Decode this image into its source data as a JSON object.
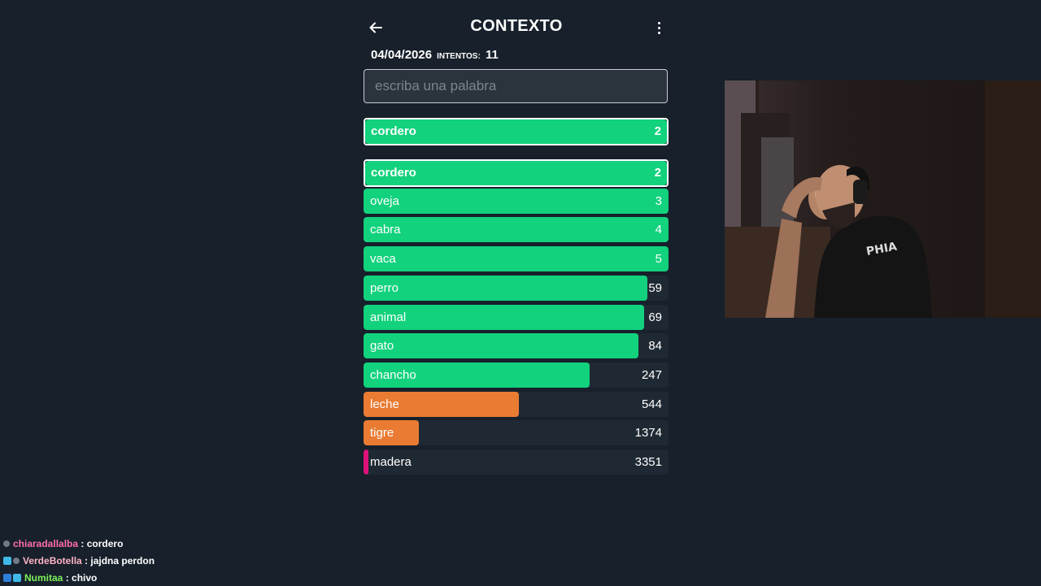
{
  "game": {
    "title": "CONTEXTO",
    "date": "04/04/2026",
    "attempts_label": "INTENTOS:",
    "attempts": "11",
    "search_placeholder": "escriba una palabra",
    "last_guess": {
      "word": "cordero",
      "rank": "2",
      "fill": 1.0,
      "color": "green"
    },
    "guesses": [
      {
        "word": "cordero",
        "rank": "2",
        "fill": 1.0,
        "color": "green",
        "highlight": true
      },
      {
        "word": "oveja",
        "rank": "3",
        "fill": 1.0,
        "color": "green"
      },
      {
        "word": "cabra",
        "rank": "4",
        "fill": 1.0,
        "color": "green"
      },
      {
        "word": "vaca",
        "rank": "5",
        "fill": 1.0,
        "color": "green"
      },
      {
        "word": "perro",
        "rank": "59",
        "fill": 0.93,
        "color": "green"
      },
      {
        "word": "animal",
        "rank": "69",
        "fill": 0.92,
        "color": "green"
      },
      {
        "word": "gato",
        "rank": "84",
        "fill": 0.9,
        "color": "green"
      },
      {
        "word": "chancho",
        "rank": "247",
        "fill": 0.74,
        "color": "green"
      },
      {
        "word": "leche",
        "rank": "544",
        "fill": 0.51,
        "color": "orange"
      },
      {
        "word": "tigre",
        "rank": "1374",
        "fill": 0.18,
        "color": "orange"
      },
      {
        "word": "madera",
        "rank": "3351",
        "fill": 0.015,
        "color": "pink"
      }
    ]
  },
  "colors": {
    "green": "#12d27d",
    "orange": "#e97b32",
    "pink": "#e1117c",
    "background": "#17202b"
  },
  "chat": [
    {
      "user": "chiaradallalba",
      "user_color": "#ff6fa8",
      "message": ": cordero",
      "badges": [
        "round"
      ]
    },
    {
      "user": "VerdeBotella",
      "user_color": "#ffb3c6",
      "message": ": jajdna perdon",
      "badges": [
        "cyan",
        "round"
      ]
    },
    {
      "user": "Numitaa",
      "user_color": "#7cf05a",
      "message": ": chivo",
      "badges": [
        "blue",
        "cyan"
      ]
    }
  ]
}
